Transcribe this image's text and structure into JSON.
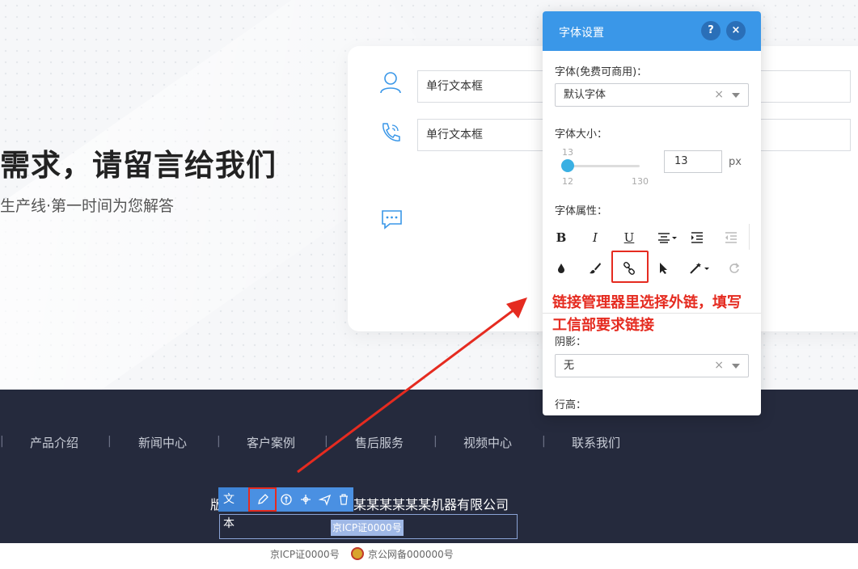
{
  "hero": {
    "title": "需求，请留言给我们",
    "subtitle": "生产线·第一时间为您解答"
  },
  "form": {
    "name_field": "单行文本框",
    "phone_field": "单行文本框"
  },
  "footer": {
    "nav": [
      "产品介绍",
      "新闻中心",
      "客户案例",
      "售后服务",
      "视频中心",
      "联系我们"
    ],
    "separator": "|",
    "copyright_left": "版",
    "copyright_right": "某某某某某某机器有限公司",
    "toolbar_label": "文本",
    "icp_selected": "京ICP证0000号",
    "icp_bottom": "京ICP证0000号",
    "police_record": "京公网备000000号"
  },
  "panel": {
    "title": "字体设置",
    "help_label": "?",
    "close_label": "×",
    "font_label": "字体(免费可商用)：",
    "font_value": "默认字体",
    "size_label": "字体大小：",
    "slider_current": "13",
    "slider_min": "12",
    "slider_max": "130",
    "size_value": "13",
    "size_unit": "px",
    "attr_label": "字体属性：",
    "bold": "B",
    "italic": "I",
    "underline": "U",
    "shadow_label": "阴影：",
    "shadow_value": "无",
    "line_height_label": "行高：",
    "clear": "×"
  },
  "annotation": {
    "line1": "链接管理器里选择外链，填写",
    "line2": "工信部要求链接"
  },
  "colors": {
    "panel_header": "#3a97e8",
    "footer_bg": "#252a3d",
    "annotation_red": "#e52b20",
    "toolbar_blue": "#4a90e2"
  }
}
